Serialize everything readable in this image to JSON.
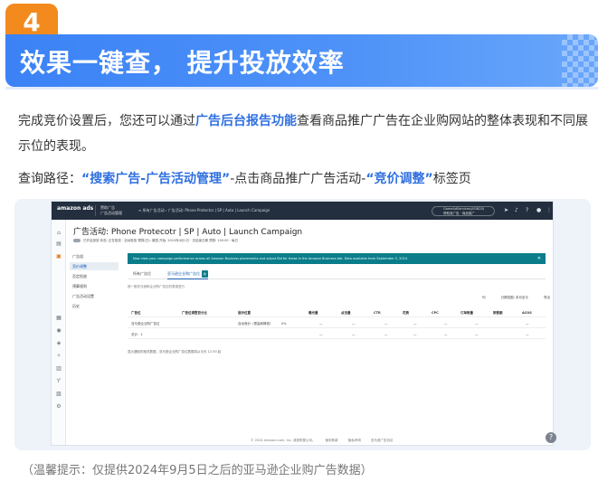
{
  "step": {
    "number": "4",
    "title": "效果一键查， 提升投放效率"
  },
  "intro": {
    "part1": "完成竞价设置后，您还可以通过",
    "highlight": "广告后台报告功能",
    "part2": "查看商品推广广告在企业购网站的整体表现和不同展示位的表现。"
  },
  "query_path": {
    "label": "查询路径：",
    "step1": "“搜索广告-广告活动管理”",
    "mid": "-点击商品推广广告活动-",
    "step2": "“竞价调整”",
    "end": "标签页"
  },
  "screenshot": {
    "logo": "amazon ads",
    "logo_sub": "",
    "product_line1": "赞助广告",
    "product_line2": "广告活动管理",
    "breadcrumb": "≡ 所有广告活动 › 广告活动: Phone Protector | SP | Auto | Launch Campaign",
    "account_line1": "GameAdServices(ASIN20)",
    "account_line2": "赞助商广告 · 商品推广",
    "campaign_title": "广告活动: Phone Protecotr | SP | Auto | Launch Campaign",
    "campaign_meta": "已开启投放   状态: 正在投放 · 自动投放   预算(日): 美国   开始: 2024年4月1日 · 无结束日期   预算: 100.00 · 每日",
    "notice": "Now view your campaign performance across all Amazon Business placements and adjust Bid for these in the Amazon Business tab. Data available from September 5, 2024",
    "subnav": [
      "广告组",
      "竞价调整",
      "否定投放",
      "预算规则",
      "广告活动设置",
      "历史"
    ],
    "tabs": [
      "所有广告位",
      "亚马逊企业购广告位"
    ],
    "tab_badge": "新",
    "hint": "按一般亚马逊和企业购广告位的表现进行",
    "filters": [
      "列",
      "日期范围: 本月至今",
      "导出"
    ],
    "table_headers": [
      "广告位",
      "广告位调整百分比",
      "展示位置",
      "曝光量",
      "点击量",
      "CTR",
      "花费",
      "CPC",
      "订单数量",
      "销售额",
      "ACOS"
    ],
    "table_rows": [
      [
        "亚马逊企业购广告位",
        "",
        "自动竞价（提高和降低）",
        "0%",
        "—",
        "—",
        "—",
        "—",
        "—",
        "—",
        "—"
      ],
      [
        "总计：1",
        "",
        "",
        "",
        "—",
        "—",
        "—",
        "—",
        "—",
        "—",
        "—"
      ]
    ],
    "table_note": "显示通知的相关数据，亚马逊企业购广告位数据将从今天 12:30 起",
    "footer": [
      "© 2024 Amazon.com, Inc. 或其附属公司。",
      "使用条款",
      "隐私声明",
      "亚马逊广告协议"
    ]
  },
  "footnote": "（温馨提示：仅提供2024年9月5日之后的亚马逊企业购广告数据）",
  "colors": {
    "banner": "#3b82f6",
    "badge": "#f28a1e",
    "highlight": "#2f6fe0"
  }
}
